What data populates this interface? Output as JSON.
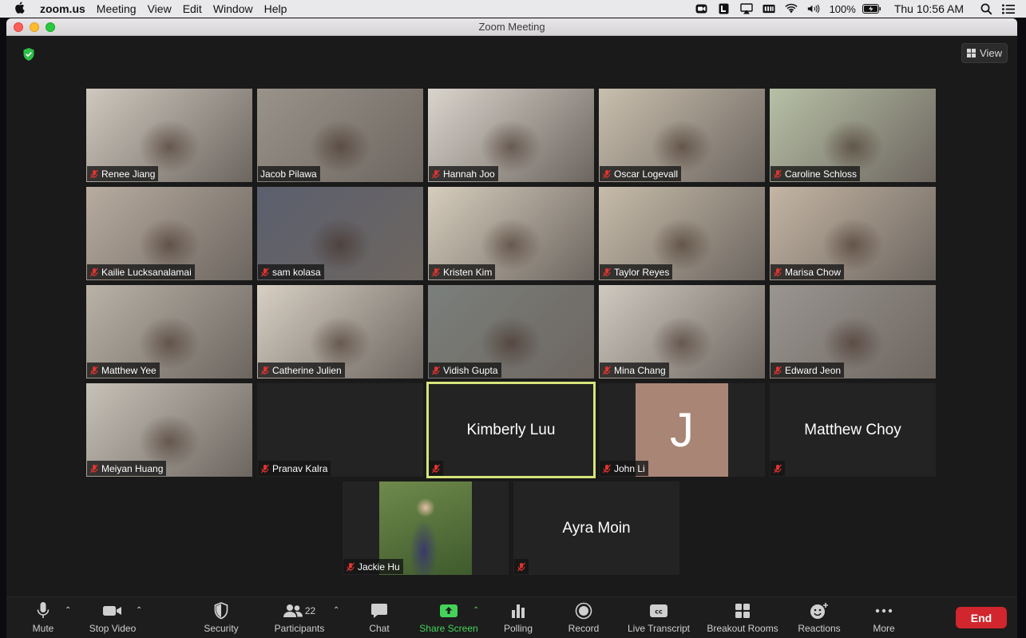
{
  "menubar": {
    "app_name": "zoom.us",
    "items": [
      "Meeting",
      "View",
      "Edit",
      "Window",
      "Help"
    ],
    "battery": "100%",
    "clock": "Thu 10:56 AM"
  },
  "window": {
    "title": "Zoom Meeting",
    "view_label": "View"
  },
  "participants_grid": [
    {
      "name": "Renee Jiang",
      "muted": true,
      "type": "video",
      "bg": "#cfc8be"
    },
    {
      "name": "Jacob Pilawa",
      "muted": false,
      "type": "video",
      "bg": "#9a938a"
    },
    {
      "name": "Hannah Joo",
      "muted": true,
      "type": "video",
      "bg": "#d9d4cc"
    },
    {
      "name": "Oscar Logevall",
      "muted": true,
      "type": "video",
      "bg": "#c9bfae"
    },
    {
      "name": "Caroline Schloss",
      "muted": true,
      "type": "video",
      "bg": "#b7c0a6"
    },
    {
      "name": "Kailie Lucksanalamai",
      "muted": true,
      "type": "video",
      "bg": "#b8aca0"
    },
    {
      "name": "sam kolasa",
      "muted": true,
      "type": "video",
      "bg": "#5b5f6e"
    },
    {
      "name": "Kristen Kim",
      "muted": true,
      "type": "video",
      "bg": "#d6cdbd"
    },
    {
      "name": "Taylor Reyes",
      "muted": true,
      "type": "video",
      "bg": "#c7bcaa"
    },
    {
      "name": "Marisa Chow",
      "muted": true,
      "type": "video",
      "bg": "#c4b5a4"
    },
    {
      "name": "Matthew Yee",
      "muted": true,
      "type": "video",
      "bg": "#b9b2a7"
    },
    {
      "name": "Catherine Julien",
      "muted": true,
      "type": "video",
      "bg": "#d8d0c4"
    },
    {
      "name": "Vidish Gupta",
      "muted": true,
      "type": "video",
      "bg": "#7b7f7c"
    },
    {
      "name": "Mina Chang",
      "muted": true,
      "type": "video",
      "bg": "#cfc9c0"
    },
    {
      "name": "Edward Jeon",
      "muted": true,
      "type": "video",
      "bg": "#9a9590"
    },
    {
      "name": "Meiyan Huang",
      "muted": true,
      "type": "video",
      "bg": "#c7c2b8"
    },
    {
      "name": "Pranav Kalra",
      "muted": true,
      "type": "off",
      "bg": "#232323"
    },
    {
      "name": "Kimberly Luu",
      "muted": true,
      "type": "bigname",
      "bg": "#232323",
      "speaking": true
    },
    {
      "name": "John Li",
      "muted": true,
      "type": "avatar",
      "bg": "#232323",
      "initial": "J"
    },
    {
      "name": "Matthew Choy",
      "muted": true,
      "type": "bigname",
      "bg": "#232323"
    },
    {
      "name": "Jackie Hu",
      "muted": true,
      "type": "photo",
      "bg": "#232323"
    },
    {
      "name": "Ayra Moin",
      "muted": true,
      "type": "bigname",
      "bg": "#232323"
    }
  ],
  "toolbar": {
    "mute": "Mute",
    "stop_video": "Stop Video",
    "security": "Security",
    "participants": "Participants",
    "participants_count": "22",
    "chat": "Chat",
    "share_screen": "Share Screen",
    "polling": "Polling",
    "record": "Record",
    "live_transcript": "Live Transcript",
    "breakout_rooms": "Breakout Rooms",
    "reactions": "Reactions",
    "more": "More",
    "end": "End"
  },
  "colors": {
    "accent_green": "#44d35a",
    "end_red": "#d1262d",
    "speaker_border": "#d6e47a",
    "mute_red": "#e0342f"
  }
}
